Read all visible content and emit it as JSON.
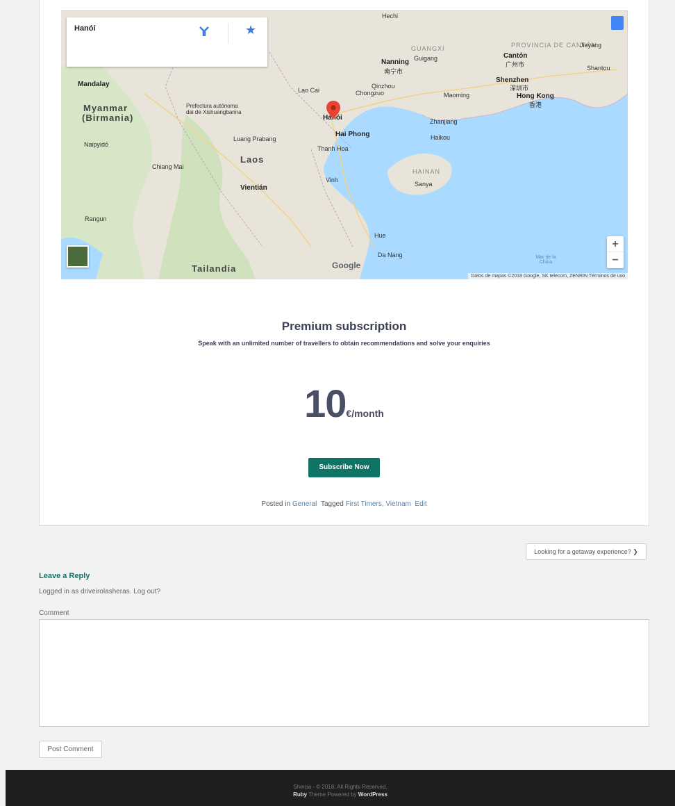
{
  "map": {
    "info_title": "Hanói",
    "attribution": "Datos de mapas ©2018 Google, SK telecom, ZENRIN   Términos de uso",
    "google_logo": "Google",
    "zoom_in": "+",
    "zoom_out": "−",
    "labels": {
      "myanmar": "Myanmar",
      "birmania": "(Birmania)",
      "laos": "Laos",
      "tailandia": "Tailandia",
      "guangxi": "GUANGXI",
      "provincia_canton": "PROVINCIA DE CANTÓN",
      "hainan": "HAINAN",
      "hanoi": "Hanói",
      "hai_phong": "Hai Phong",
      "nanning": "Nanning",
      "nanning_cn": "南宁市",
      "canton": "Cantón",
      "canton_cn": "广州市",
      "shenzhen": "Shenzhen",
      "shenzhen_cn": "深圳市",
      "hong_kong": "Hong Kong",
      "hong_kong_cn": "香港",
      "mandalay": "Mandalay",
      "naipyido": "Naipyidó",
      "rangun": "Rangun",
      "vientian": "Vientián",
      "chiang_mai": "Chiang Mai",
      "thanh_hoa": "Thanh Hoa",
      "vinh": "Vinh",
      "hue": "Hue",
      "da_nang": "Da Nang",
      "sanya": "Sanya",
      "haikou": "Haikou",
      "zhanjiang": "Zhanjiang",
      "maoming": "Maoming",
      "qinzhou": "Qinzhou",
      "chongzuo": "Chongzuo",
      "lao_cai": "Lao Cai",
      "hechi": "Hechi",
      "guigang": "Guigang",
      "shantou": "Shantou",
      "jieyang": "Jieyang",
      "luang_prabang": "Luang Prabang",
      "prefectura": "Prefectura autónoma dai de Xishuangbanna",
      "mar_china": "Mar de la China"
    }
  },
  "plan": {
    "title": "Premium subscription",
    "subtitle": "Speak with an unlimited number of travellers to obtain recommendations and solve your enquiries",
    "price": "10",
    "unit": "€/month",
    "button": "Subscribe Now"
  },
  "meta": {
    "posted_in": "Posted in",
    "category": "General",
    "tagged": "Tagged",
    "tag1": "First Timers,",
    "tag2": "Vietnam",
    "edit": "Edit"
  },
  "nav": {
    "next": "Looking for a getaway experience? ❯"
  },
  "reply": {
    "title": "Leave a Reply",
    "logged_in": "Logged in as driveirolasheras. Log out?",
    "comment_label": "Comment",
    "post_button": "Post Comment"
  },
  "footer": {
    "line1": "Sherpa - © 2018. All Rights Reserved.",
    "theme": "Ruby",
    "line2_mid": "Theme Powered by",
    "wordpress": "WordPress"
  },
  "colors": {
    "accent": "#0f7466",
    "map_water": "#aadaff",
    "map_land": "#e8e4da",
    "footer": "#1f1f1f"
  }
}
